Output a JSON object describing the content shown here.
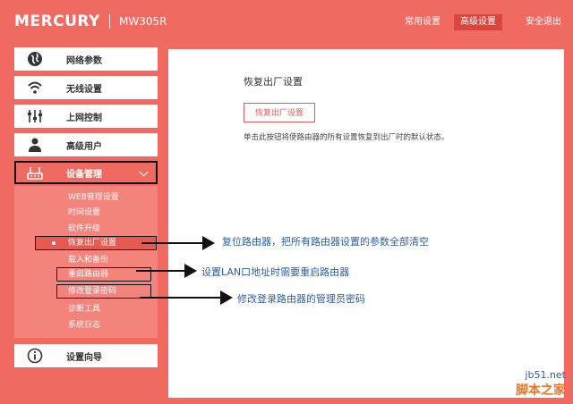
{
  "header": {
    "brand": "MERCURY",
    "model": "MW305R",
    "nav": [
      {
        "label": "常用设置",
        "active": false
      },
      {
        "label": "高级设置",
        "active": true
      },
      {
        "label": "安全退出",
        "active": false
      }
    ]
  },
  "sidebar": {
    "items": [
      {
        "label": "网络参数",
        "icon": "globe-icon"
      },
      {
        "label": "无线设置",
        "icon": "wifi-icon"
      },
      {
        "label": "上网控制",
        "icon": "sliders-icon"
      },
      {
        "label": "高级用户",
        "icon": "user-icon"
      },
      {
        "label": "设备管理",
        "icon": "router-icon",
        "active": true
      },
      {
        "label": "设置向导",
        "icon": "info-icon"
      }
    ],
    "submenu": [
      "WEB管理设置",
      "时间设置",
      "软件升级",
      "恢复出厂设置",
      "载入和备份",
      "重启路由器",
      "修改登录密码",
      "诊断工具",
      "系统日志"
    ]
  },
  "main": {
    "title": "恢复出厂设置",
    "button_label": "恢复出厂设置",
    "description": "单击此按钮将使路由器的所有设置恢复到出厂时的默认状态。"
  },
  "annotations": [
    "复位路由器，把所有路由器设置的参数全部清空",
    "设置LAN口地址时需要重启路由器",
    "修改登录路由器的管理员密码"
  ],
  "watermark": {
    "site": "jb51.net",
    "name": "脚本之家"
  },
  "colors": {
    "accent": "#f06a62",
    "accent_dark": "#d8463e",
    "annotation_text": "#2b5fa8"
  }
}
